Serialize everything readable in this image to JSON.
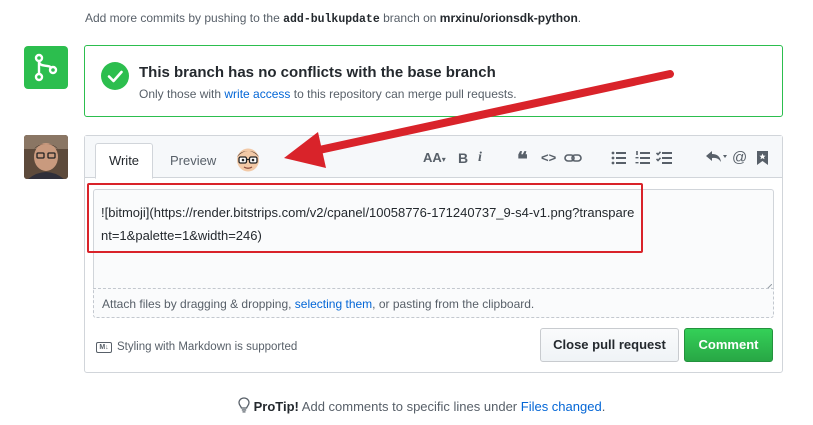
{
  "hint": {
    "prefix": "Add more commits by pushing to the",
    "branch": "add-bulkupdate",
    "middle": "branch on",
    "repo": "mrxinu/orionsdk-python",
    "suffix": "."
  },
  "merge": {
    "title": "This branch has no conflicts with the base branch",
    "desc_prefix": "Only those with",
    "desc_link": "write access",
    "desc_suffix": "to this repository can merge pull requests."
  },
  "tabs": {
    "write": "Write",
    "preview": "Preview"
  },
  "toolbar": {
    "icons": [
      "text-size-icon",
      "bold-icon",
      "italic-icon",
      "quote-icon",
      "code-icon",
      "link-icon",
      "unordered-list-icon",
      "ordered-list-icon",
      "task-list-icon",
      "reply-icon",
      "mention-icon",
      "bookmark-icon"
    ],
    "labels": {
      "textsize": "AA",
      "bold": "B",
      "italic": "i",
      "quote": "❝",
      "code": "<>",
      "mention": "@"
    }
  },
  "editor": {
    "value": "![bitmoji](https://render.bitstrips.com/v2/cpanel/10058776-171240737_9-s4-v1.png?transparent=1&palette=1&width=246)"
  },
  "attach": {
    "prefix": "Attach files by dragging & dropping,",
    "link": "selecting them",
    "suffix": ", or pasting from the clipboard."
  },
  "markdown": {
    "icon": "M↓",
    "text": "Styling with Markdown is supported"
  },
  "buttons": {
    "close": "Close pull request",
    "comment": "Comment"
  },
  "protip": {
    "label": "ProTip!",
    "text": "Add comments to specific lines under",
    "link": "Files changed",
    "suffix": "."
  },
  "colors": {
    "green": "#2cbe4e",
    "link": "#0366d6",
    "annotation_red": "#d9232a"
  }
}
